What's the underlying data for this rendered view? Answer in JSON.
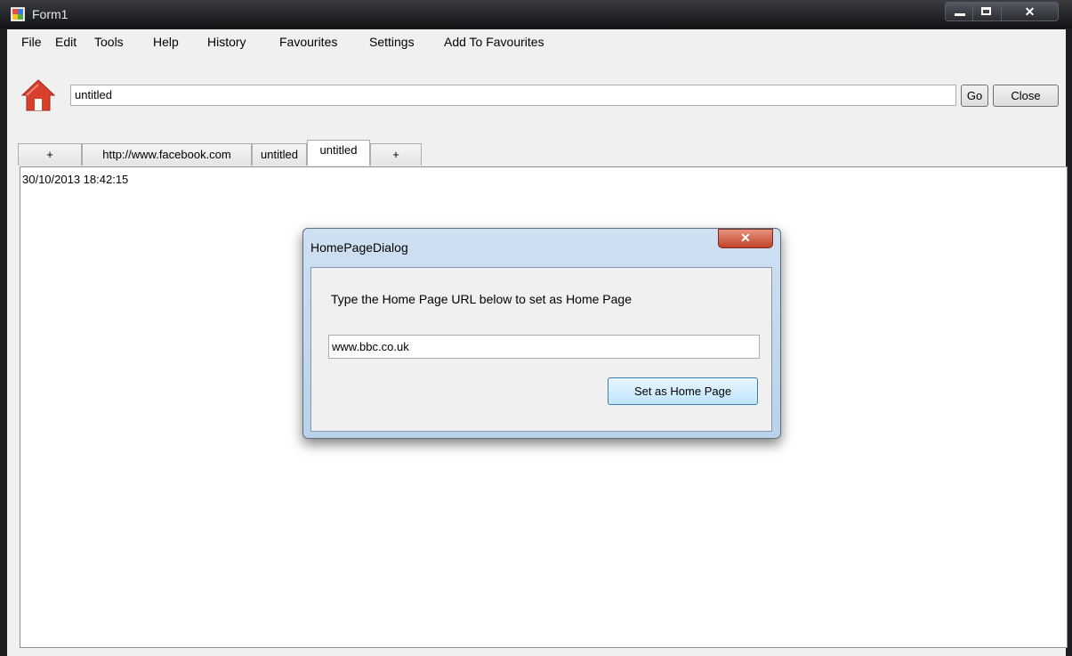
{
  "window": {
    "title": "Form1"
  },
  "menu": {
    "items": [
      "File",
      "Edit",
      "Tools",
      "Help",
      "History",
      "Favourites",
      "Settings",
      "Add To Favourites"
    ]
  },
  "toolbar": {
    "address_value": "untitled",
    "go_label": "Go",
    "close_label": "Close"
  },
  "tabs": [
    {
      "label": "+"
    },
    {
      "label": "http://www.facebook.com"
    },
    {
      "label": "untitled"
    },
    {
      "label": "untitled",
      "active": true
    },
    {
      "label": "+"
    }
  ],
  "content": {
    "timestamp": "30/10/2013 18:42:15"
  },
  "dialog": {
    "title": "HomePageDialog",
    "close_glyph": "x",
    "instruction": "Type the Home Page URL below to set as Home Page",
    "url_value": "www.bbc.co.uk",
    "button_label": "Set as Home Page"
  },
  "icons": {
    "home": "home-icon",
    "app": "app-icon"
  },
  "colors": {
    "home_icon": "#d9402b",
    "titlebar": "#1d1f22",
    "dialog_button": "#bee6fd"
  }
}
